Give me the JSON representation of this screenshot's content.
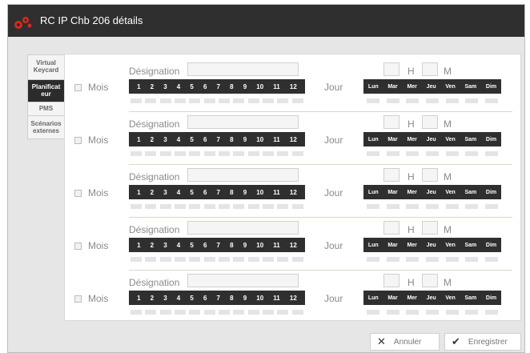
{
  "window": {
    "title": "RC IP Chb 206 détails",
    "icon": "red-gears-logo",
    "accent_color": "#d42a1e"
  },
  "tabs": [
    {
      "label": "Virtual Keycard",
      "active": false
    },
    {
      "label": "Planificat eur",
      "active": true
    },
    {
      "label": "PMS",
      "active": false
    },
    {
      "label": "Scénarios externes",
      "active": false
    }
  ],
  "schedule": {
    "designation_label": "Désignation",
    "mois_label": "Mois",
    "jour_label": "Jour",
    "h_label": "H",
    "m_label": "M",
    "months": [
      "1",
      "2",
      "3",
      "4",
      "5",
      "6",
      "7",
      "8",
      "9",
      "10",
      "11",
      "12"
    ],
    "days": [
      "Lun",
      "Mar",
      "Mer",
      "Jeu",
      "Ven",
      "Sam",
      "Dim"
    ],
    "rows": [
      {
        "designation": "",
        "hour": "",
        "minute": "",
        "mois_checked": false
      },
      {
        "designation": "",
        "hour": "",
        "minute": "",
        "mois_checked": false
      },
      {
        "designation": "",
        "hour": "",
        "minute": "",
        "mois_checked": false
      },
      {
        "designation": "",
        "hour": "",
        "minute": "",
        "mois_checked": false
      },
      {
        "designation": "",
        "hour": "",
        "minute": "",
        "mois_checked": false
      }
    ]
  },
  "footer": {
    "cancel_label": "Annuler",
    "cancel_icon": "close-icon",
    "save_label": "Enregistrer",
    "save_icon": "check-icon"
  }
}
